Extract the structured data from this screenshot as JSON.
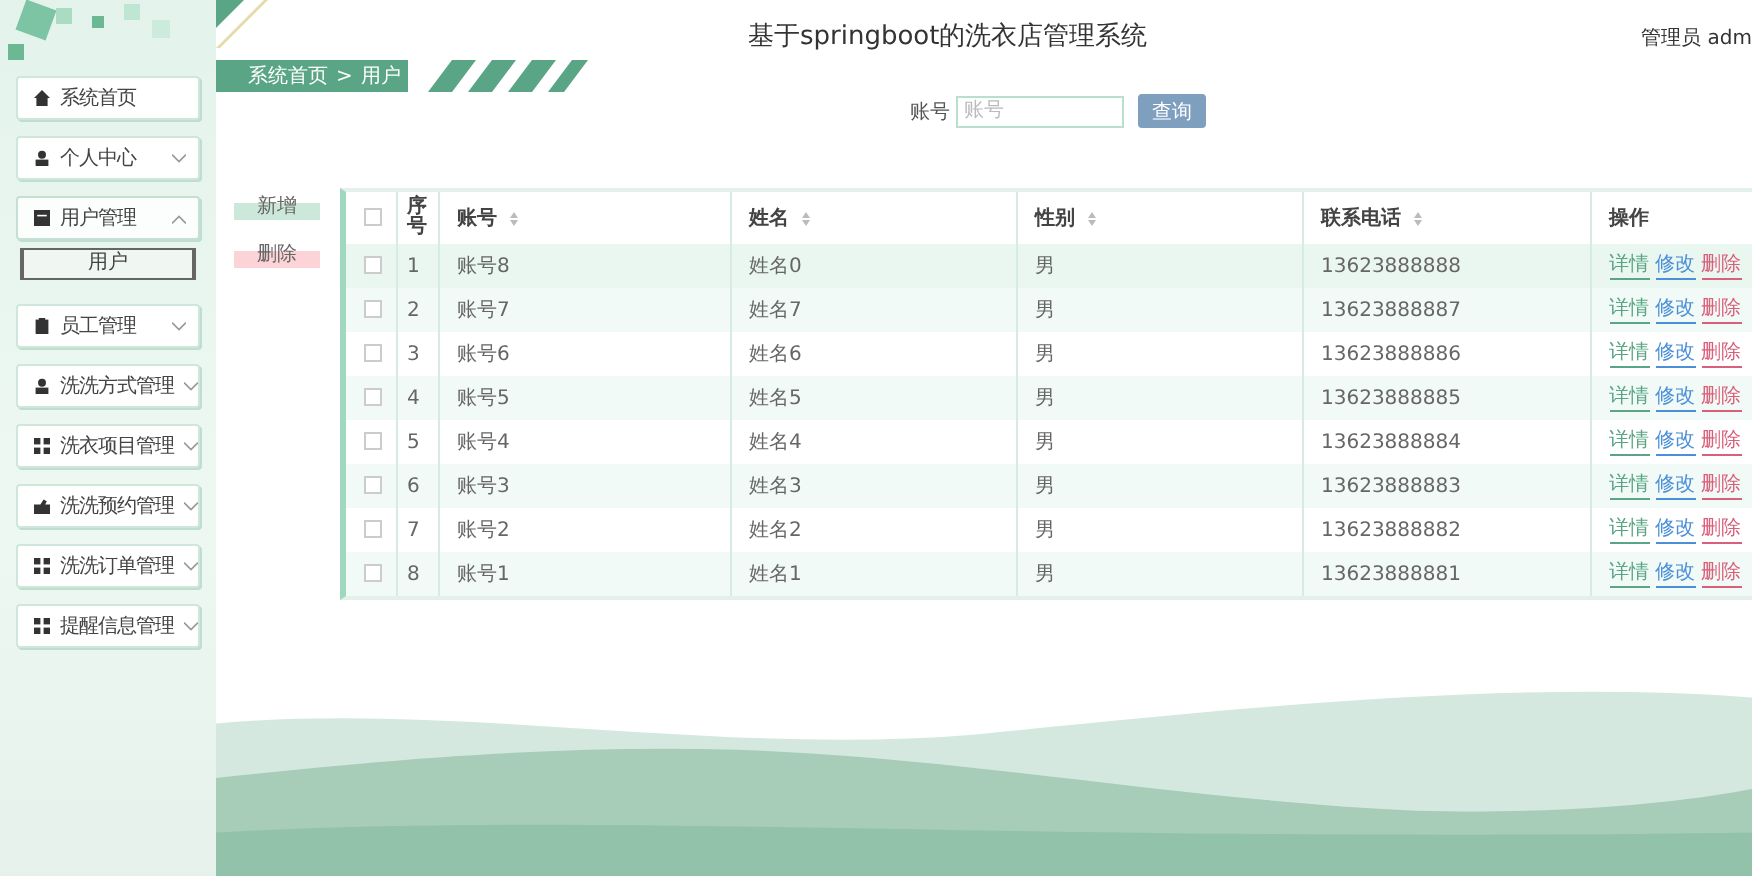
{
  "sidebar": {
    "items": [
      {
        "kind": "link",
        "label": "系统首页"
      },
      {
        "kind": "menu",
        "label": "个人中心",
        "expanded": false
      },
      {
        "kind": "menu",
        "label": "用户管理",
        "expanded": true,
        "children": [
          {
            "label": "用户",
            "selected": true
          }
        ]
      },
      {
        "kind": "menu",
        "label": "员工管理",
        "expanded": false
      },
      {
        "kind": "menu",
        "label": "洗洗方式管理",
        "expanded": false
      },
      {
        "kind": "menu",
        "label": "洗衣项目管理",
        "expanded": false
      },
      {
        "kind": "menu",
        "label": "洗洗预约管理",
        "expanded": false
      },
      {
        "kind": "menu",
        "label": "洗洗订单管理",
        "expanded": false
      },
      {
        "kind": "menu",
        "label": "提醒信息管理",
        "expanded": false
      }
    ]
  },
  "header": {
    "title": "基于springboot的洗衣店管理系统",
    "user": "管理员 adm"
  },
  "breadcrumb": [
    "系统首页",
    ">",
    "用户"
  ],
  "search": {
    "label": "账号",
    "placeholder": "账号",
    "button": "查询"
  },
  "actions": [
    {
      "kind": "add",
      "label": "新增"
    },
    {
      "kind": "delete",
      "label": "删除"
    }
  ],
  "table": {
    "header_checked": false,
    "columns": [
      {
        "label": "序号",
        "sortable": false
      },
      {
        "label": "账号",
        "sortable": true
      },
      {
        "label": "姓名",
        "sortable": true
      },
      {
        "label": "性别",
        "sortable": true
      },
      {
        "label": "联系电话",
        "sortable": true
      },
      {
        "label": "操作",
        "sortable": false
      }
    ],
    "rows": [
      {
        "checked": false,
        "cells": [
          "1",
          "账号8",
          "姓名0",
          "男",
          "13623888888"
        ],
        "actions": [
          {
            "kind": "detail",
            "label": "详情"
          },
          {
            "kind": "edit",
            "label": "修改"
          },
          {
            "kind": "delete",
            "label": "删除"
          }
        ]
      },
      {
        "checked": false,
        "cells": [
          "2",
          "账号7",
          "姓名7",
          "男",
          "13623888887"
        ],
        "actions": [
          {
            "kind": "detail",
            "label": "详情"
          },
          {
            "kind": "edit",
            "label": "修改"
          },
          {
            "kind": "delete",
            "label": "删除"
          }
        ]
      },
      {
        "checked": false,
        "cells": [
          "3",
          "账号6",
          "姓名6",
          "男",
          "13623888886"
        ],
        "actions": [
          {
            "kind": "detail",
            "label": "详情"
          },
          {
            "kind": "edit",
            "label": "修改"
          },
          {
            "kind": "delete",
            "label": "删除"
          }
        ]
      },
      {
        "checked": false,
        "cells": [
          "4",
          "账号5",
          "姓名5",
          "男",
          "13623888885"
        ],
        "actions": [
          {
            "kind": "detail",
            "label": "详情"
          },
          {
            "kind": "edit",
            "label": "修改"
          },
          {
            "kind": "delete",
            "label": "删除"
          }
        ]
      },
      {
        "checked": false,
        "cells": [
          "5",
          "账号4",
          "姓名4",
          "男",
          "13623888884"
        ],
        "actions": [
          {
            "kind": "detail",
            "label": "详情"
          },
          {
            "kind": "edit",
            "label": "修改"
          },
          {
            "kind": "delete",
            "label": "删除"
          }
        ]
      },
      {
        "checked": false,
        "cells": [
          "6",
          "账号3",
          "姓名3",
          "男",
          "13623888883"
        ],
        "actions": [
          {
            "kind": "detail",
            "label": "详情"
          },
          {
            "kind": "edit",
            "label": "修改"
          },
          {
            "kind": "delete",
            "label": "删除"
          }
        ]
      },
      {
        "checked": false,
        "cells": [
          "7",
          "账号2",
          "姓名2",
          "男",
          "13623888882"
        ],
        "actions": [
          {
            "kind": "detail",
            "label": "详情"
          },
          {
            "kind": "edit",
            "label": "修改"
          },
          {
            "kind": "delete",
            "label": "删除"
          }
        ]
      },
      {
        "checked": false,
        "cells": [
          "8",
          "账号1",
          "姓名1",
          "男",
          "13623888881"
        ],
        "actions": [
          {
            "kind": "detail",
            "label": "详情"
          },
          {
            "kind": "edit",
            "label": "修改"
          },
          {
            "kind": "delete",
            "label": "删除"
          }
        ]
      }
    ]
  }
}
